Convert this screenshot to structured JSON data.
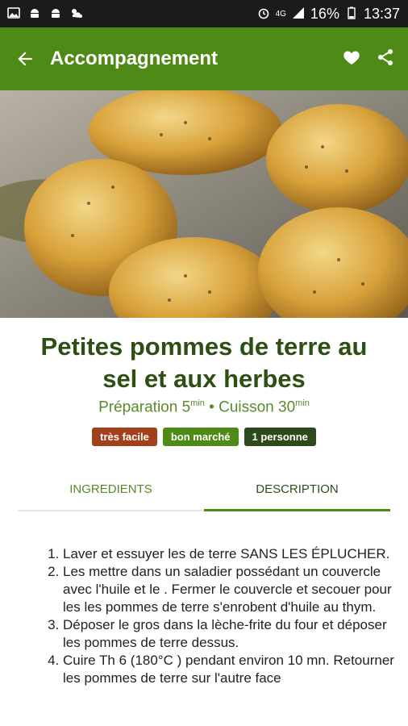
{
  "statusbar": {
    "battery": "16%",
    "time": "13:37",
    "network": "4G"
  },
  "appbar": {
    "title": "Accompagnement",
    "bg_color": "#4e8a16"
  },
  "recipe": {
    "title_line1": "Petites pommes de terre au",
    "title_line2": "sel et aux herbes",
    "prep_label": "Préparation 5",
    "prep_unit": "min",
    "separator": " • ",
    "cook_label": "Cuisson 30",
    "cook_unit": "min",
    "badges": [
      {
        "label": "très facile",
        "color": "#a3401c"
      },
      {
        "label": "bon marché",
        "color": "#4e8a16"
      },
      {
        "label": "1 personne",
        "color": "#2c4a1a"
      }
    ]
  },
  "tabs": [
    {
      "label": "INGREDIENTS",
      "active": false
    },
    {
      "label": "DESCRIPTION",
      "active": true
    }
  ],
  "steps": [
    "Laver et essuyer les de terre SANS LES ÉPLUCHER.",
    "Les mettre dans un saladier possédant un couvercle avec l'huile et le . Fermer le couvercle et secouer pour les les pommes de terre s'enrobent d'huile au thym.",
    "Déposer le gros dans la lèche-frite du four et déposer les pommes de terre dessus.",
    "Cuire Th 6 (180°C ) pendant environ 10 mn. Retourner les pommes de terre sur l'autre face"
  ]
}
